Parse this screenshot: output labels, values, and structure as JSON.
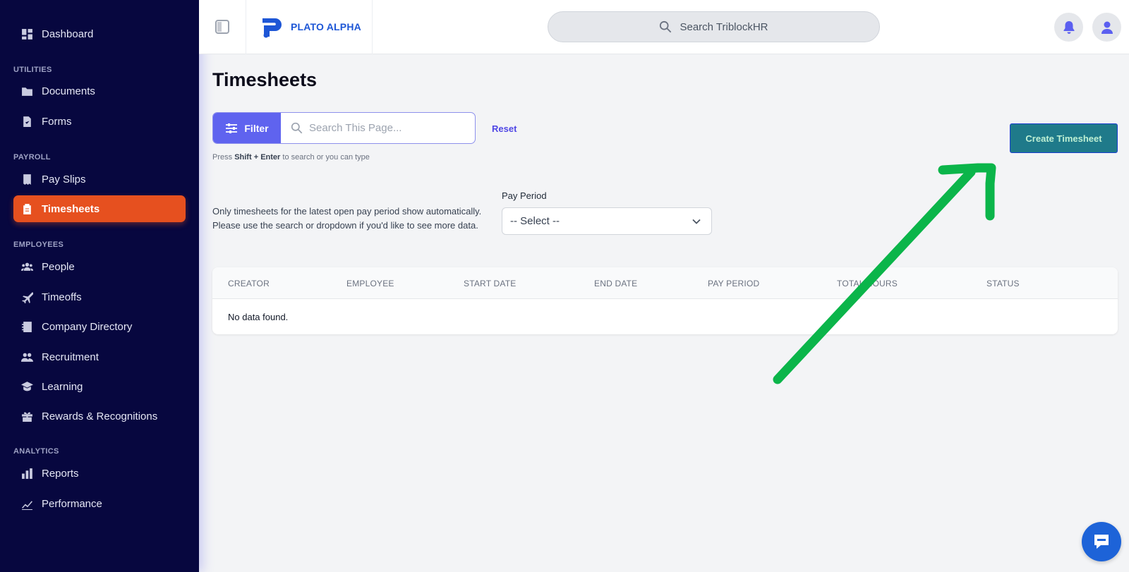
{
  "sidebar": {
    "items": [
      {
        "label": "Dashboard",
        "icon": "dashboard-icon"
      },
      {
        "label": "Documents",
        "icon": "folder-icon"
      },
      {
        "label": "Forms",
        "icon": "form-check-icon"
      },
      {
        "label": "Pay Slips",
        "icon": "receipt-icon"
      },
      {
        "label": "Timesheets",
        "icon": "clipboard-icon",
        "active": true
      },
      {
        "label": "People",
        "icon": "people-icon"
      },
      {
        "label": "Timeoffs",
        "icon": "plane-icon"
      },
      {
        "label": "Company Directory",
        "icon": "address-book-icon"
      },
      {
        "label": "Recruitment",
        "icon": "user-group-icon"
      },
      {
        "label": "Learning",
        "icon": "graduation-icon"
      },
      {
        "label": "Rewards & Recognitions",
        "icon": "gift-icon"
      },
      {
        "label": "Reports",
        "icon": "bar-chart-icon"
      },
      {
        "label": "Performance",
        "icon": "trend-icon"
      }
    ],
    "sections": {
      "utilities": "UTILITIES",
      "payroll": "PAYROLL",
      "employees": "EMPLOYEES",
      "analytics": "ANALYTICS"
    }
  },
  "header": {
    "logo_text": "PLATO ALPHA",
    "search_placeholder": "Search TriblockHR"
  },
  "main": {
    "title": "Timesheets",
    "filter_label": "Filter",
    "search_placeholder": "Search This Page...",
    "reset_label": "Reset",
    "hint": {
      "press": "Press",
      "shift": "Shift",
      "plus": "+",
      "enter": "Enter",
      "rest": "to search or you can type"
    },
    "create_label": "Create Timesheet",
    "info_line1": "Only timesheets for the latest open pay period show automatically.",
    "info_line2": "Please use the search or dropdown if you'd like to see more data.",
    "pay_period_label": "Pay Period",
    "pay_period_value": "-- Select --",
    "table": {
      "columns": [
        "CREATOR",
        "EMPLOYEE",
        "START DATE",
        "END DATE",
        "PAY PERIOD",
        "TOTAL HOURS",
        "STATUS"
      ],
      "empty_text": "No data found."
    }
  },
  "colors": {
    "sidebar_bg": "#07073f",
    "active_item": "#e6501f",
    "accent": "#5f63ef",
    "create_button": "#1f7a8a",
    "annotation_arrow": "#0bb54a",
    "chat_button": "#1d63d8"
  }
}
